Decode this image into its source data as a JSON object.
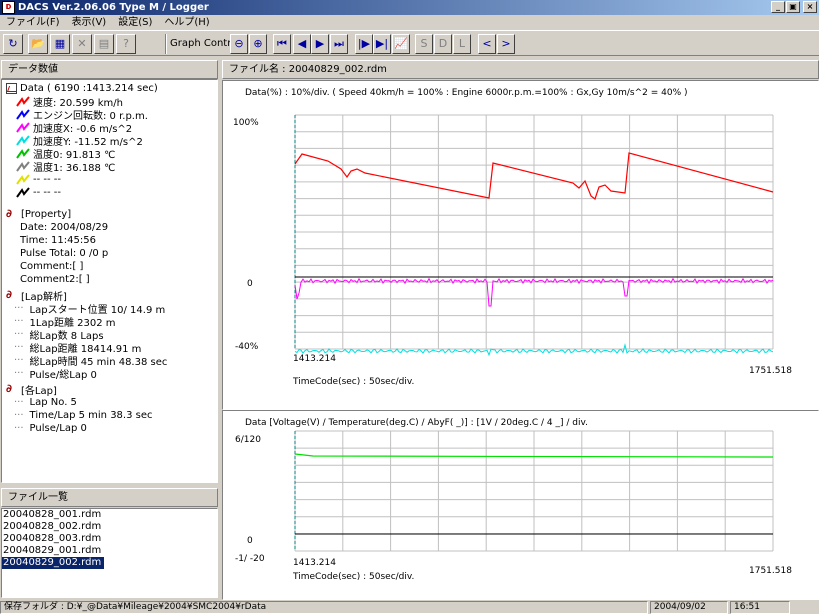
{
  "window": {
    "title": "DACS Ver.2.06.06 Type M / Logger",
    "icon_name": "dacs-app-icon"
  },
  "window_buttons": [
    {
      "name": "minimize-icon",
      "glyph": "_"
    },
    {
      "name": "maximize-icon",
      "glyph": "▣"
    },
    {
      "name": "close-icon",
      "glyph": "×"
    }
  ],
  "menu": [
    "ファイル(F)",
    "表示(V)",
    "設定(S)",
    "ヘルプ(H)"
  ],
  "toolbar": {
    "graph_control_label": "Graph Control",
    "buttons_left": [
      {
        "name": "logger-icon",
        "glyph": "↻"
      },
      {
        "name": "open-icon",
        "glyph": "📂"
      },
      {
        "name": "save-icon",
        "glyph": "▦"
      },
      {
        "name": "delete-icon",
        "glyph": "✕",
        "disabled": true
      },
      {
        "name": "copy-icon",
        "glyph": "▤",
        "disabled": true
      },
      {
        "name": "help-icon",
        "glyph": "?",
        "disabled": true
      }
    ],
    "buttons_right": [
      {
        "name": "zoom-out-icon",
        "glyph": "⊖"
      },
      {
        "name": "zoom-in-icon",
        "glyph": "⊕"
      },
      {
        "name": "first-icon",
        "glyph": "⏮"
      },
      {
        "name": "prev-icon",
        "glyph": "◀"
      },
      {
        "name": "next-icon",
        "glyph": "▶"
      },
      {
        "name": "last-icon",
        "glyph": "⏭"
      },
      {
        "name": "start-cursor-icon",
        "glyph": "|▶"
      },
      {
        "name": "end-cursor-icon",
        "glyph": "▶|"
      },
      {
        "name": "graph-icon",
        "glyph": "📈"
      },
      {
        "name": "s-button",
        "glyph": "S",
        "disabled": true
      },
      {
        "name": "d-button",
        "glyph": "D",
        "disabled": true
      },
      {
        "name": "l-button",
        "glyph": "L",
        "disabled": true
      },
      {
        "name": "scroll-left-icon",
        "glyph": "<"
      },
      {
        "name": "scroll-right-icon",
        "glyph": ">"
      }
    ]
  },
  "left_panel": {
    "header": "データ数値",
    "data_root": "Data ( 6190 :1413.214 sec)",
    "channels": [
      {
        "label": "速度: 20.599 km/h",
        "color": "#ff0000"
      },
      {
        "label": "エンジン回転数: 0 r.p.m.",
        "color": "#0000ff"
      },
      {
        "label": "加速度X: -0.6 m/s^2",
        "color": "#ff00ff"
      },
      {
        "label": "加速度Y: -11.52 m/s^2",
        "color": "#00e0e0"
      },
      {
        "label": "温度0: 91.813 ℃",
        "color": "#00c000"
      },
      {
        "label": "温度1: 36.188 ℃",
        "color": "#808080"
      },
      {
        "label": "-- -- --",
        "color": "#e0e000"
      },
      {
        "label": "-- -- --",
        "color": "#000000"
      }
    ],
    "property": {
      "title": "[Property]",
      "items": [
        "Date: 2004/08/29",
        "Time: 11:45:56",
        "Pulse Total: 0 /0 p",
        "Comment:[ ]",
        "Comment2:[ ]"
      ]
    },
    "lap_analysis": {
      "title": "[Lap解析]",
      "items": [
        "Lapスタート位置  10/ 14.9 m",
        "1Lap距離  2302  m",
        "総Lap数  8 Laps",
        "総Lap距離  18414.91 m",
        "総Lap時間  45 min 48.38 sec",
        "Pulse/総Lap   0"
      ]
    },
    "each_lap": {
      "title": "[各Lap]",
      "items": [
        "Lap No.   5",
        "Time/Lap  5 min 38.3 sec",
        "Pulse/Lap   0"
      ]
    }
  },
  "file_list": {
    "header": "ファイル一覧",
    "files": [
      "20040828_001.rdm",
      "20040828_002.rdm",
      "20040828_003.rdm",
      "20040829_001.rdm",
      "20040829_002.rdm"
    ],
    "selected_index": 4
  },
  "graph_header": "ファイル名 : 20040829_002.rdm",
  "graph1": {
    "caption": "Data(%) : 10%/div. ( Speed  40km/h = 100% : Engine  6000r.p.m.=100% : Gx,Gy  10m/s^2 = 40% )",
    "y_top": "100%",
    "y_mid": "0",
    "y_bottom": "-40%",
    "x_start": "1413.214",
    "x_end": "1751.518",
    "xlabel": "TimeCode(sec) :   50sec/div.",
    "colors": {
      "speed": "#ff0000",
      "gx": "#ff00ff",
      "gy": "#00e0e0",
      "engine": "#0000ff",
      "grid": "#c0c0c0"
    }
  },
  "graph2": {
    "caption": "Data [Voltage(V) / Temperature(deg.C) / AbyF( _)] : [1V / 20deg.C / 4 _] / div.",
    "y_top": "6/120",
    "y_mid": "0",
    "y_bottom": "-1/ -20",
    "x_start": "1413.214",
    "x_end": "1751.518",
    "xlabel": "TimeCode(sec) :   50sec/div.",
    "colors": {
      "temp0": "#00e000",
      "grid": "#c0c0c0"
    }
  },
  "status": {
    "folder": "保存フォルダ : D:¥_@Data¥Mileage¥2004¥SMC2004¥rData",
    "date": "2004/09/02",
    "time": "16:51"
  }
}
